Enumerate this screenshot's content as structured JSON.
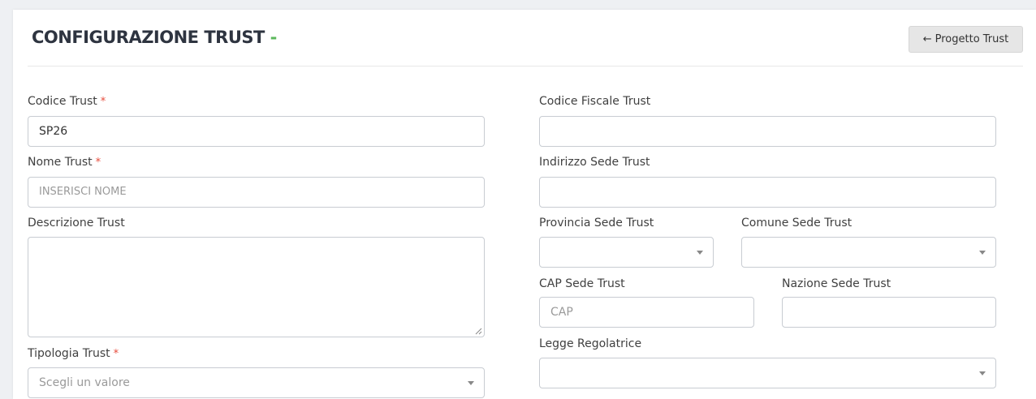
{
  "header": {
    "title": "CONFIGURAZIONE TRUST",
    "title_suffix": "-",
    "back_button_label": "Progetto Trust"
  },
  "form": {
    "codice_trust": {
      "label": "Codice Trust",
      "required_mark": "*",
      "value": "SP26"
    },
    "nome_trust": {
      "label": "Nome Trust",
      "required_mark": "*",
      "placeholder": "INSERISCI NOME"
    },
    "descrizione_trust": {
      "label": "Descrizione Trust"
    },
    "tipologia_trust": {
      "label": "Tipologia Trust",
      "required_mark": "*",
      "placeholder": "Scegli un valore"
    },
    "codice_fiscale_trust": {
      "label": "Codice Fiscale Trust",
      "value": ""
    },
    "indirizzo_sede_trust": {
      "label": "Indirizzo Sede Trust",
      "value": ""
    },
    "provincia_sede_trust": {
      "label": "Provincia Sede Trust",
      "value": ""
    },
    "comune_sede_trust": {
      "label": "Comune Sede Trust",
      "value": ""
    },
    "cap_sede_trust": {
      "label": "CAP Sede Trust",
      "placeholder": "CAP"
    },
    "nazione_sede_trust": {
      "label": "Nazione Sede Trust",
      "value": ""
    },
    "legge_regolatrice": {
      "label": "Legge Regolatrice",
      "value": ""
    }
  },
  "colors": {
    "accent_dash": "#5cb85c",
    "required": "#e74c3c",
    "title": "#2e3440"
  },
  "icons": {
    "back": "arrow-left-icon",
    "select": "chevron-down-icon"
  }
}
